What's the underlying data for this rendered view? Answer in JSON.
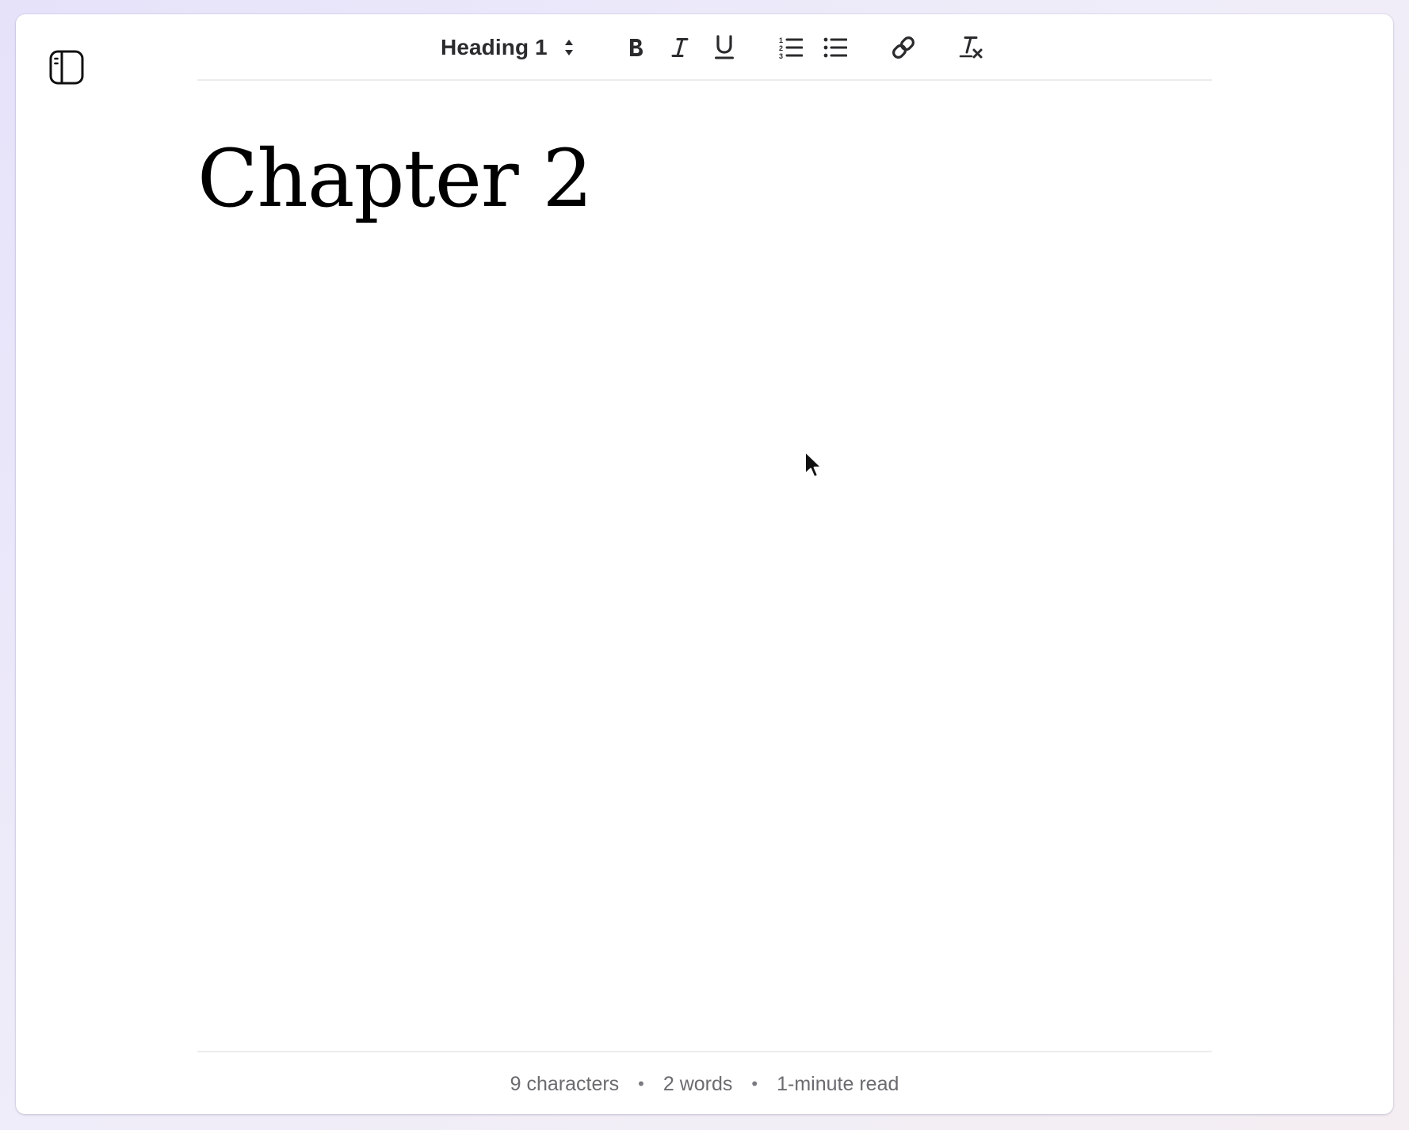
{
  "toolbar": {
    "block_type": "Heading 1",
    "icons": {
      "sidebar": "sidebar-icon",
      "block_type_arrows": "up-down-chevron-icon",
      "bold": "bold-icon",
      "italic": "italic-icon",
      "underline": "underline-icon",
      "ordered_list": "ordered-list-icon",
      "unordered_list": "bullet-list-icon",
      "link": "link-icon",
      "clear_format": "clear-format-icon"
    }
  },
  "document": {
    "heading": "Chapter 2"
  },
  "stats": {
    "characters": "9 characters",
    "separator": "•",
    "words": "2 words",
    "read_time": "1-minute read"
  },
  "colors": {
    "text": "#000000",
    "icon": "#2b2b2e",
    "muted": "#6b6b70",
    "divider": "#ececee",
    "backdrop": "#e6e2fa"
  }
}
